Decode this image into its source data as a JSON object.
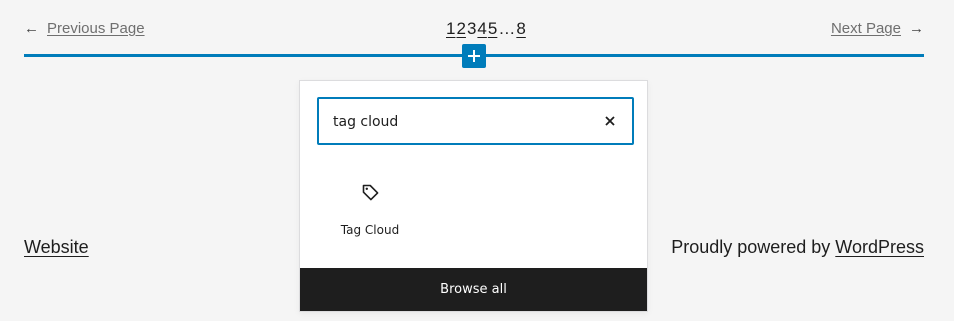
{
  "pagination": {
    "prev_arrow": "←",
    "prev_label": "Previous Page",
    "next_label": "Next Page",
    "next_arrow": "→",
    "pages": [
      "1",
      "2",
      "3",
      "4",
      "5",
      "…",
      "8"
    ],
    "current_page": "3"
  },
  "inserter": {
    "plus_icon": "plus-icon",
    "search": {
      "value": "tag cloud",
      "clear_icon": "close-icon"
    },
    "results": [
      {
        "icon": "tag-icon",
        "label": "Tag Cloud"
      }
    ],
    "browse_all_label": "Browse all"
  },
  "footer": {
    "left_link": "Website",
    "right_prefix": "Proudly powered by ",
    "right_link": "WordPress"
  },
  "colors": {
    "accent": "#007cba",
    "background": "#f5f5f5",
    "dark": "#1e1e1e"
  }
}
